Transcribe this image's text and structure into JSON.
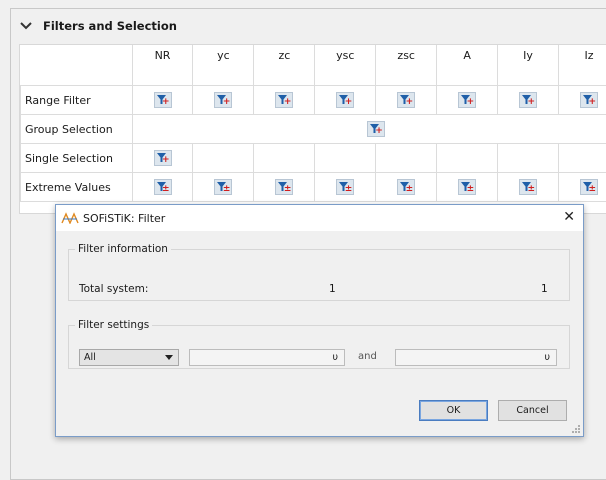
{
  "panel": {
    "title": "Filters and Selection"
  },
  "columns": [
    "NR",
    "yc",
    "zc",
    "ysc",
    "zsc",
    "A",
    "Iy",
    "Iz"
  ],
  "rows": [
    {
      "label": "Range Filter",
      "kind": "all",
      "sign": "+"
    },
    {
      "label": "Group Selection",
      "kind": "merged",
      "sign": "+"
    },
    {
      "label": "Single Selection",
      "kind": "first",
      "sign": "+"
    },
    {
      "label": "Extreme Values",
      "kind": "all",
      "sign": "±"
    }
  ],
  "dialog": {
    "title": "SOFiSTiK: Filter",
    "close": "✕",
    "filter_info": {
      "legend": "Filter information",
      "label": "Total system:",
      "value1": "1",
      "value2": "1"
    },
    "filter_settings": {
      "legend": "Filter settings",
      "select_value": "All",
      "field1_value": "υ",
      "and_label": "and",
      "field2_value": "υ"
    },
    "ok_label": "OK",
    "cancel_label": "Cancel"
  },
  "colors": {
    "filter_icon_blue": "#1f5fa8",
    "filter_sign_red": "#d02020",
    "logo_orange": "#e08a20"
  }
}
